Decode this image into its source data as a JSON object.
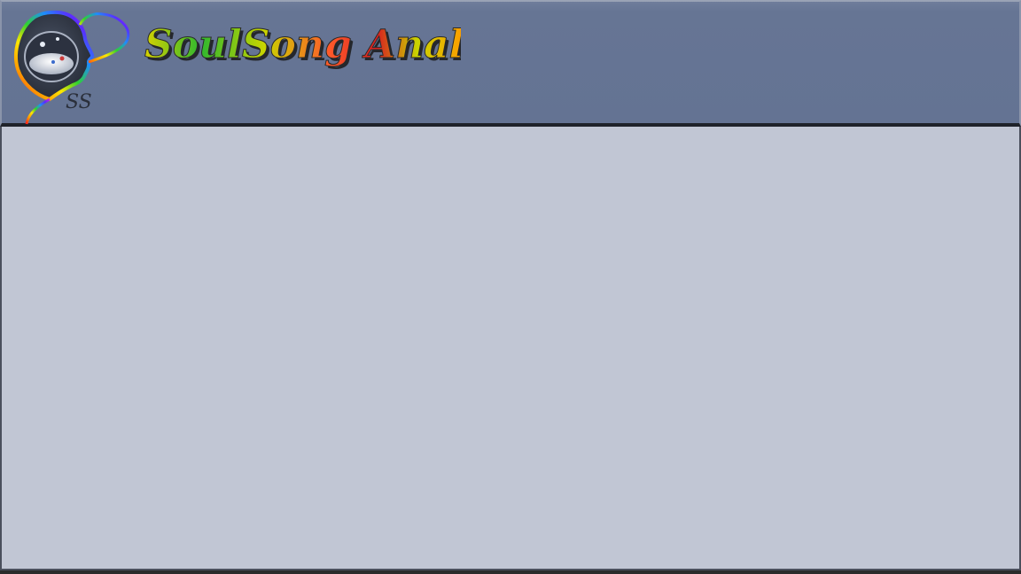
{
  "header": {
    "site_title": "SoulSong Analysis",
    "logo_initials": "SS"
  },
  "colors": {
    "header_bg": "#647393",
    "content_bg": "#c1c6d4",
    "divider": "#1f222a"
  },
  "icons": {
    "logo": "rainbow-face-profile-logo-icon"
  }
}
